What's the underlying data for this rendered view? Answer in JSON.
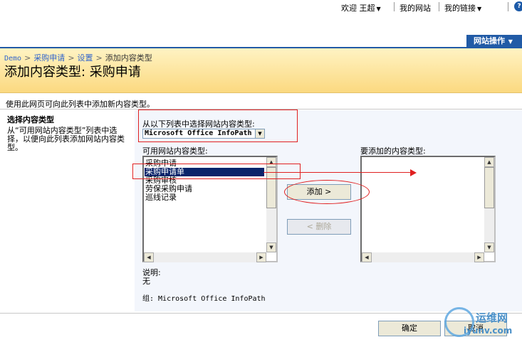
{
  "topnav": {
    "welcome": "欢迎",
    "user": "王超",
    "my_site": "我的网站",
    "my_links": "我的链接"
  },
  "site_actions": "网站操作",
  "breadcrumb": {
    "items": [
      "Demo",
      "采购申请",
      "设置",
      "添加内容类型"
    ]
  },
  "page_title": "添加内容类型: 采购申请",
  "description": "使用此网页可向此列表中添加新内容类型。",
  "section": {
    "title": "选择内容类型",
    "description": "从“可用网站内容类型”列表中选择，以便向此列表添加网站内容类型。"
  },
  "form": {
    "select_label": "从以下列表中选择网站内容类型:",
    "select_value": "Microsoft Office InfoPath",
    "available_label": "可用网站内容类型:",
    "available_items": [
      "采购申请",
      "采购申请单",
      "采购审核",
      "劳保采购申请",
      "巡线记录"
    ],
    "selected_index": 1,
    "to_add_label": "要添加的内容类型:",
    "add_button": "添加 >",
    "remove_button": "< 删除",
    "desc_label": "说明:",
    "desc_value": "无",
    "group_label": "组: Microsoft Office InfoPath"
  },
  "footer": {
    "ok": "确定",
    "cancel": "取消"
  },
  "watermark": {
    "line1": "运维网",
    "line2": "iyunv.com"
  },
  "colors": {
    "accent": "#215ba6",
    "selection": "#0a246a",
    "annotation": "#e02020"
  }
}
